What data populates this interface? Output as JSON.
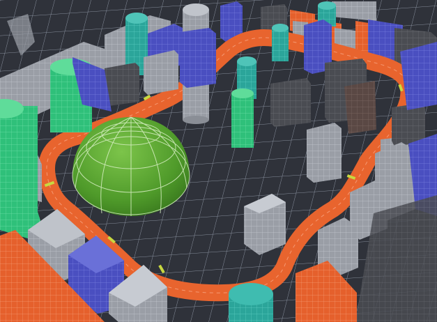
{
  "colors": {
    "ground": "#2f323a",
    "grid": "#7f8796",
    "track": "#e8642e",
    "track_edge": "#f08a5a",
    "blue": "#4a4fc0",
    "teal": "#2ba59a",
    "green": "#2fc07a",
    "grey": "#9a9ea6",
    "dark": "#4a4c52",
    "orange": "#e5602c",
    "brown": "#5a4844",
    "dome": "#5aa531"
  },
  "icons": {
    "dome": "green-dome-icon",
    "track": "race-track-icon",
    "checkpoint": "checkpoint-marker-icon"
  }
}
